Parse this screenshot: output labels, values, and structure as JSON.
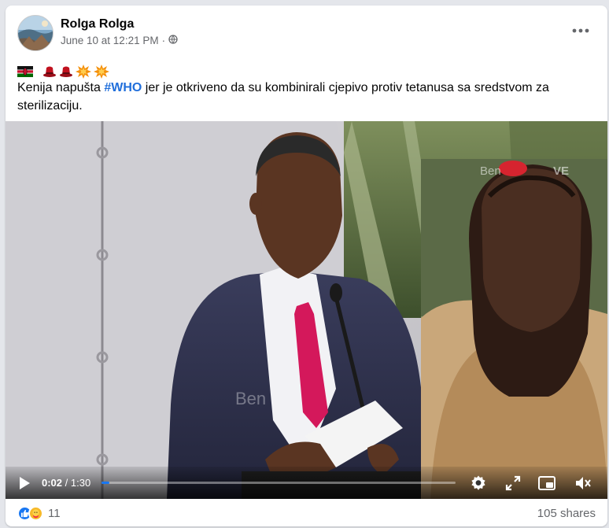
{
  "post": {
    "author": "Rolga Rolga",
    "timestamp": "June 10 at 12:21 PM",
    "separator": "·",
    "privacy_icon": "globe-icon",
    "menu_icon": "more-options-icon",
    "emojis": [
      "kenya-flag",
      "red-hat",
      "red-hat",
      "collision",
      "collision"
    ],
    "text_before": "Kenija napušta ",
    "hashtag": "#WHO",
    "text_after": " jer je otkriveno da su kombinirali cjepivo protiv tetanusa sa sredstvom za sterilizaciju."
  },
  "video": {
    "current_time": "0:02",
    "time_separator": " / ",
    "duration": "1:30",
    "progress_fraction": 0.022,
    "watermark": "Ben",
    "watermark_tag": "VE",
    "icons": [
      "play-icon",
      "settings-icon",
      "expand-icon",
      "pip-icon",
      "mute-icon"
    ],
    "accent_color": "#1877f2"
  },
  "engagement": {
    "reaction_icons": [
      "like-icon",
      "care-icon"
    ],
    "reaction_count": "11",
    "shares": "105 shares"
  }
}
